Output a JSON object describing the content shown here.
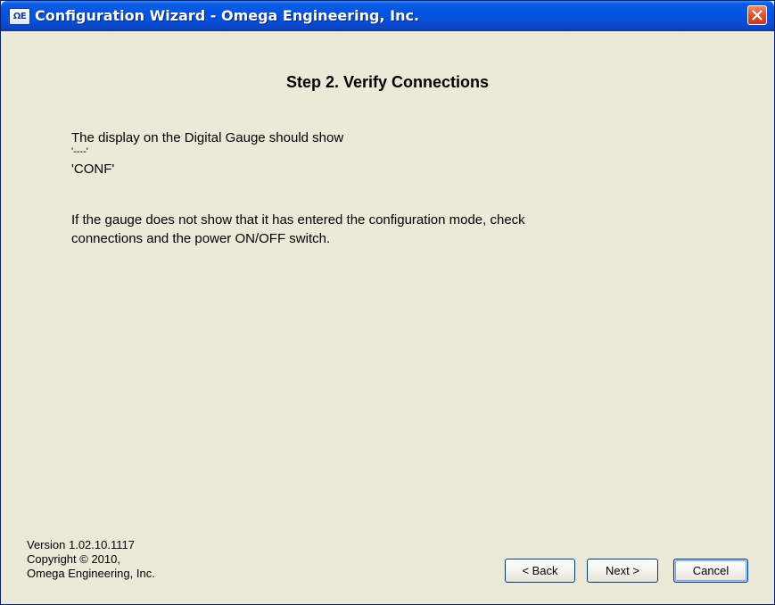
{
  "window": {
    "title": "Configuration Wizard - Omega Engineering, Inc.",
    "icon": "omega-app-icon",
    "icon_glyph": "ΩE"
  },
  "step": {
    "title": "Step 2.  Verify Connections"
  },
  "content": {
    "lines": [
      "The display on the Digital Gauge should show",
      "'----'",
      "'CONF'",
      "If the gauge does not show that it has entered the configuration mode, check",
      "connections and the power ON/OFF switch."
    ]
  },
  "footer": {
    "version": "Version 1.02.10.1117",
    "copyright": "Copyright © 2010,",
    "company": "Omega Engineering, Inc."
  },
  "buttons": {
    "back": "< Back",
    "next": "Next >",
    "cancel": "Cancel"
  },
  "colors": {
    "titlebar": "#0054e3",
    "window_bg": "#ece9d8",
    "close_button": "#e0502b"
  }
}
